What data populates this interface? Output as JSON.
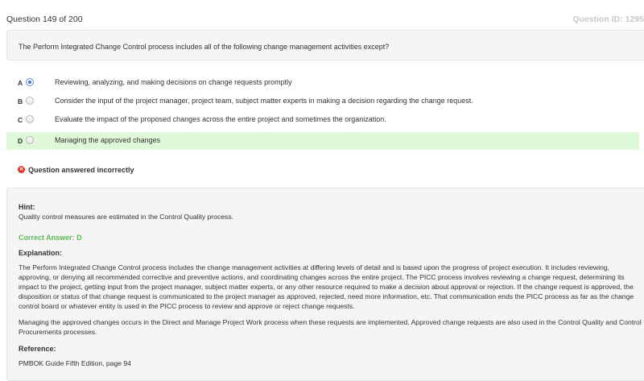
{
  "header": {
    "question_counter": "Question 149 of 200",
    "question_id": "Question ID: 1295"
  },
  "question": {
    "text": "The Perform Integrated Change Control process includes all of the following change management activities except?"
  },
  "options": [
    {
      "letter": "A",
      "text": "Reviewing, analyzing, and making decisions on change requests promptly",
      "selected": true,
      "correct": false
    },
    {
      "letter": "B",
      "text": "Consider the input of the project manager, project team, subject matter experts in making a decision regarding the change request.",
      "selected": false,
      "correct": false
    },
    {
      "letter": "C",
      "text": "Evaluate the impact of the proposed changes across the entire project and sometimes the organization.",
      "selected": false,
      "correct": false
    },
    {
      "letter": "D",
      "text": "Managing the approved changes",
      "selected": false,
      "correct": true
    }
  ],
  "status": {
    "icon": "error-x-icon",
    "text": "Question answered incorrectly",
    "color": "#d9342b"
  },
  "explanation": {
    "hint_label": "Hint:",
    "hint_text": "Quality control measures are estimated in the Control Quality process.",
    "correct_answer": "Correct Answer: D",
    "explanation_label": "Explanation:",
    "paragraph1": "The Perform Integrated Change Control process includes the change management activities at differing levels of detail and is based upon the progress of project execution. It includes reviewing, approving, or denying all recommended corrective and preventive actions, and coordinating changes across the entire project. The PICC process involves reviewing a change request, determining its impact to the project, getting input from the project manager, subject matter experts, or any other resource required to make a decision about approval or rejection. If the change request is approved, the disposition or status of that change request is communicated to the project manager as approved, rejected, need more information, etc. That communication ends the PICC process as far as the change control board or whatever entity is used in the PICC process to review and approve or reject change requests.",
    "paragraph2": "Managing the approved changes occurs in the Direct and Manage Project Work process when these requests are implemented. Approved change requests are also used in the Control Quality and Control Procurements processes.",
    "reference_label": "Reference:",
    "reference_text": "PMBOK Guide Fifth Edition, page 94"
  },
  "colors": {
    "correct_bg": "#dff8d8",
    "correct_text": "#5cb85c",
    "panel_bg": "#f5f5f5"
  }
}
